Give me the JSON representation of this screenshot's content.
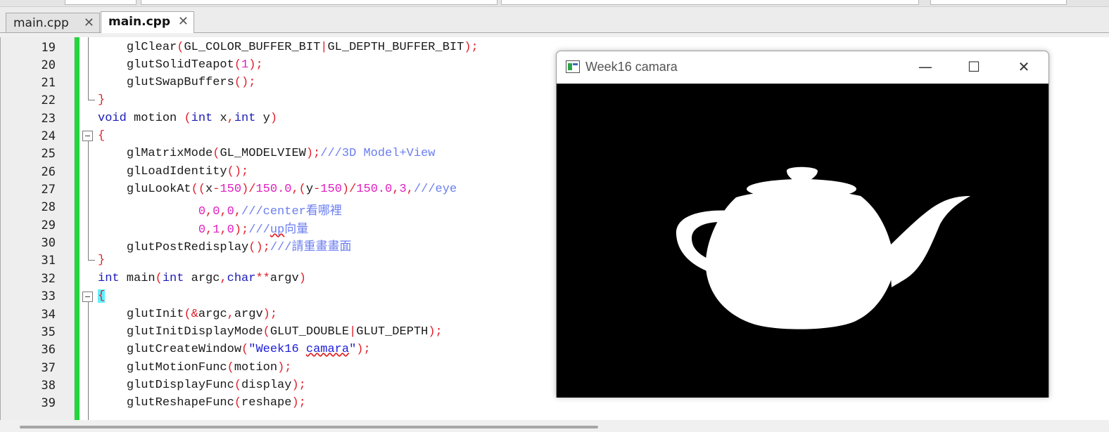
{
  "tabs": [
    {
      "label": "main.cpp",
      "close": "✕",
      "active": false
    },
    {
      "label": "main.cpp",
      "close": "✕",
      "active": true
    }
  ],
  "line_numbers": [
    "19",
    "20",
    "21",
    "22",
    "23",
    "24",
    "25",
    "26",
    "27",
    "28",
    "29",
    "30",
    "31",
    "32",
    "33",
    "34",
    "35",
    "36",
    "37",
    "38",
    "39"
  ],
  "code_tokens": {
    "l19": [
      "glClear",
      "(",
      "GL_COLOR_BUFFER_BIT",
      "|",
      "GL_DEPTH_BUFFER_BIT",
      ");"
    ],
    "l20": [
      "glutSolidTeapot",
      "(",
      "1",
      ");"
    ],
    "l21": [
      "glutSwapBuffers",
      "();"
    ],
    "l22": [
      "}"
    ],
    "l23": [
      "void",
      " motion ",
      "(",
      "int",
      " x",
      ",",
      "int",
      " y",
      ")"
    ],
    "l24": [
      "{"
    ],
    "l25": [
      "glMatrixMode",
      "(",
      "GL_MODELVIEW",
      ");",
      "///3D Model+View"
    ],
    "l26": [
      "glLoadIdentity",
      "();"
    ],
    "l27": [
      "gluLookAt",
      "((",
      "x",
      "-",
      "150",
      ")/",
      "150.0",
      ",(",
      "y",
      "-",
      "150",
      ")/",
      "150.0",
      ",",
      "3",
      ",",
      "///eye"
    ],
    "l28": [
      "0",
      ",",
      "0",
      ",",
      "0",
      ",",
      "///center看哪裡"
    ],
    "l29": [
      "0",
      ",",
      "1",
      ",",
      "0",
      ");",
      "///",
      "up",
      "向量"
    ],
    "l30": [
      "glutPostRedisplay",
      "();",
      "///請重畫畫面"
    ],
    "l31": [
      "}"
    ],
    "l32": [
      "int",
      " main",
      "(",
      "int",
      " argc",
      ",",
      "char",
      "**",
      "argv",
      ")"
    ],
    "l33": [
      "{"
    ],
    "l34": [
      "glutInit",
      "(&",
      "argc",
      ",",
      "argv",
      ");"
    ],
    "l35": [
      "glutInitDisplayMode",
      "(",
      "GLUT_DOUBLE",
      "|",
      "GLUT_DEPTH",
      ");"
    ],
    "l36": [
      "glutCreateWindow",
      "(",
      "\"Week16 ",
      "camara",
      "\"",
      ");"
    ],
    "l37": [
      "glutMotionFunc",
      "(",
      "motion",
      ");"
    ],
    "l38": [
      "glutDisplayFunc",
      "(",
      "display",
      ");"
    ],
    "l39": [
      "glutReshapeFunc",
      "(",
      "reshape",
      ");"
    ]
  },
  "glut_window": {
    "title": "Week16 camara",
    "minimize": "—",
    "maximize": "☐",
    "close": "✕"
  },
  "colors": {
    "keyword": "#1b1bb8",
    "number": "#e020c0",
    "operator": "#e0202c",
    "comment": "#6b7ef0",
    "string": "#1d1ddb",
    "change_bar": "#21d73c"
  }
}
